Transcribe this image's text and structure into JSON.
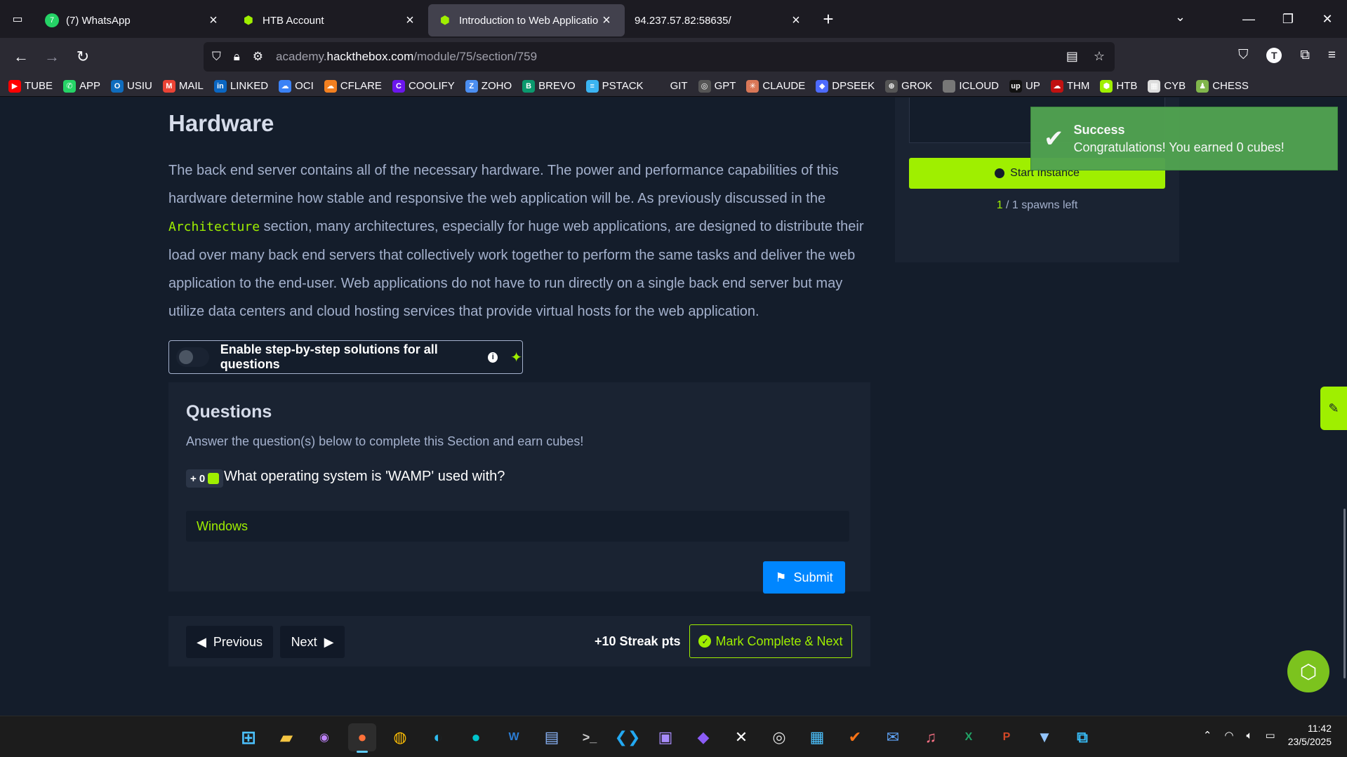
{
  "tabs": [
    {
      "title": "(7) WhatsApp",
      "favicon": "whatsapp-icon",
      "color": "#25d366",
      "active": false
    },
    {
      "title": "HTB Account",
      "favicon": "htb-cube-icon",
      "color": "#9fef00",
      "active": false
    },
    {
      "title": "Introduction to Web Applicatior",
      "favicon": "htb-cube-icon",
      "color": "#9fef00",
      "active": true
    },
    {
      "title": "94.237.57.82:58635/",
      "favicon": "",
      "color": "",
      "active": false
    }
  ],
  "url": {
    "prefix": "academy.",
    "domain": "hackthebox.com",
    "path": "/module/75/section/759"
  },
  "bookmarks": [
    {
      "label": "TUBE",
      "color": "#ff0000",
      "glyph": "▶"
    },
    {
      "label": "APP",
      "color": "#25d366",
      "glyph": "✆"
    },
    {
      "label": "USIU",
      "color": "#0f6cbd",
      "glyph": "O"
    },
    {
      "label": "MAIL",
      "color": "#ea4335",
      "glyph": "M"
    },
    {
      "label": "LINKED",
      "color": "#0a66c2",
      "glyph": "in"
    },
    {
      "label": "OCI",
      "color": "#3b82f6",
      "glyph": "☁"
    },
    {
      "label": "CFLARE",
      "color": "#f38020",
      "glyph": "☁"
    },
    {
      "label": "COOLIFY",
      "color": "#6b16ed",
      "glyph": "C"
    },
    {
      "label": "ZOHO",
      "color": "#4b8ef1",
      "glyph": "Z"
    },
    {
      "label": "BREVO",
      "color": "#0b996e",
      "glyph": "B"
    },
    {
      "label": "PSTACK",
      "color": "#3bb4f2",
      "glyph": "≡"
    },
    {
      "label": "GIT",
      "color": "#2b2a33",
      "glyph": ""
    },
    {
      "label": "GPT",
      "color": "#555555",
      "glyph": "◎"
    },
    {
      "label": "CLAUDE",
      "color": "#d97757",
      "glyph": "✳"
    },
    {
      "label": "DPSEEK",
      "color": "#4d6bfe",
      "glyph": "◆"
    },
    {
      "label": "GROK",
      "color": "#555555",
      "glyph": "⊕"
    },
    {
      "label": "ICLOUD",
      "color": "#777777",
      "glyph": ""
    },
    {
      "label": "UP",
      "color": "#111111",
      "glyph": "up"
    },
    {
      "label": "THM",
      "color": "#c11111",
      "glyph": "☁"
    },
    {
      "label": "HTB",
      "color": "#9fef00",
      "glyph": "⬢"
    },
    {
      "label": "CYB",
      "color": "#dddddd",
      "glyph": "▦"
    },
    {
      "label": "CHESS",
      "color": "#81b64c",
      "glyph": "♟"
    }
  ],
  "content": {
    "section_title": "Hardware",
    "para_part1": "The back end server contains all of the necessary hardware. The power and performance capabilities of this hardware determine how stable and responsive the web application will be. As previously discussed in the ",
    "para_code": "Architecture",
    "para_part2": " section, many architectures, especially for huge web applications, are designed to distribute their load over many back end servers that collectively work together to perform the same tasks and deliver the web application to the end-user. Web applications do not have to run directly on a single back end server but may utilize data centers and cloud hosting services that provide virtual hosts for the web application.",
    "toggle_label": "Enable step-by-step solutions for all questions"
  },
  "questions": {
    "title": "Questions",
    "subtitle": "Answer the question(s) below to complete this Section and earn cubes!",
    "items": [
      {
        "reward": "+ 0",
        "text": "What operating system is 'WAMP' used with?",
        "answer": "Windows"
      }
    ],
    "submit_label": "Submit"
  },
  "footer_nav": {
    "previous": "Previous",
    "next": "Next",
    "streak": "+10 Streak pts",
    "mark_complete": "Mark Complete & Next"
  },
  "instance": {
    "start_label": "Start Instance",
    "spawns_used": "1",
    "spawns_rest": " / 1 spawns left"
  },
  "toast": {
    "title": "Success",
    "message": "Congratulations! You earned 0 cubes!"
  },
  "clock": {
    "time": "11:42",
    "date": "23/5/2025"
  },
  "colors": {
    "accent": "#9fef00",
    "submit": "#0086ff",
    "toast": "#51a351",
    "background": "#141d2b"
  }
}
